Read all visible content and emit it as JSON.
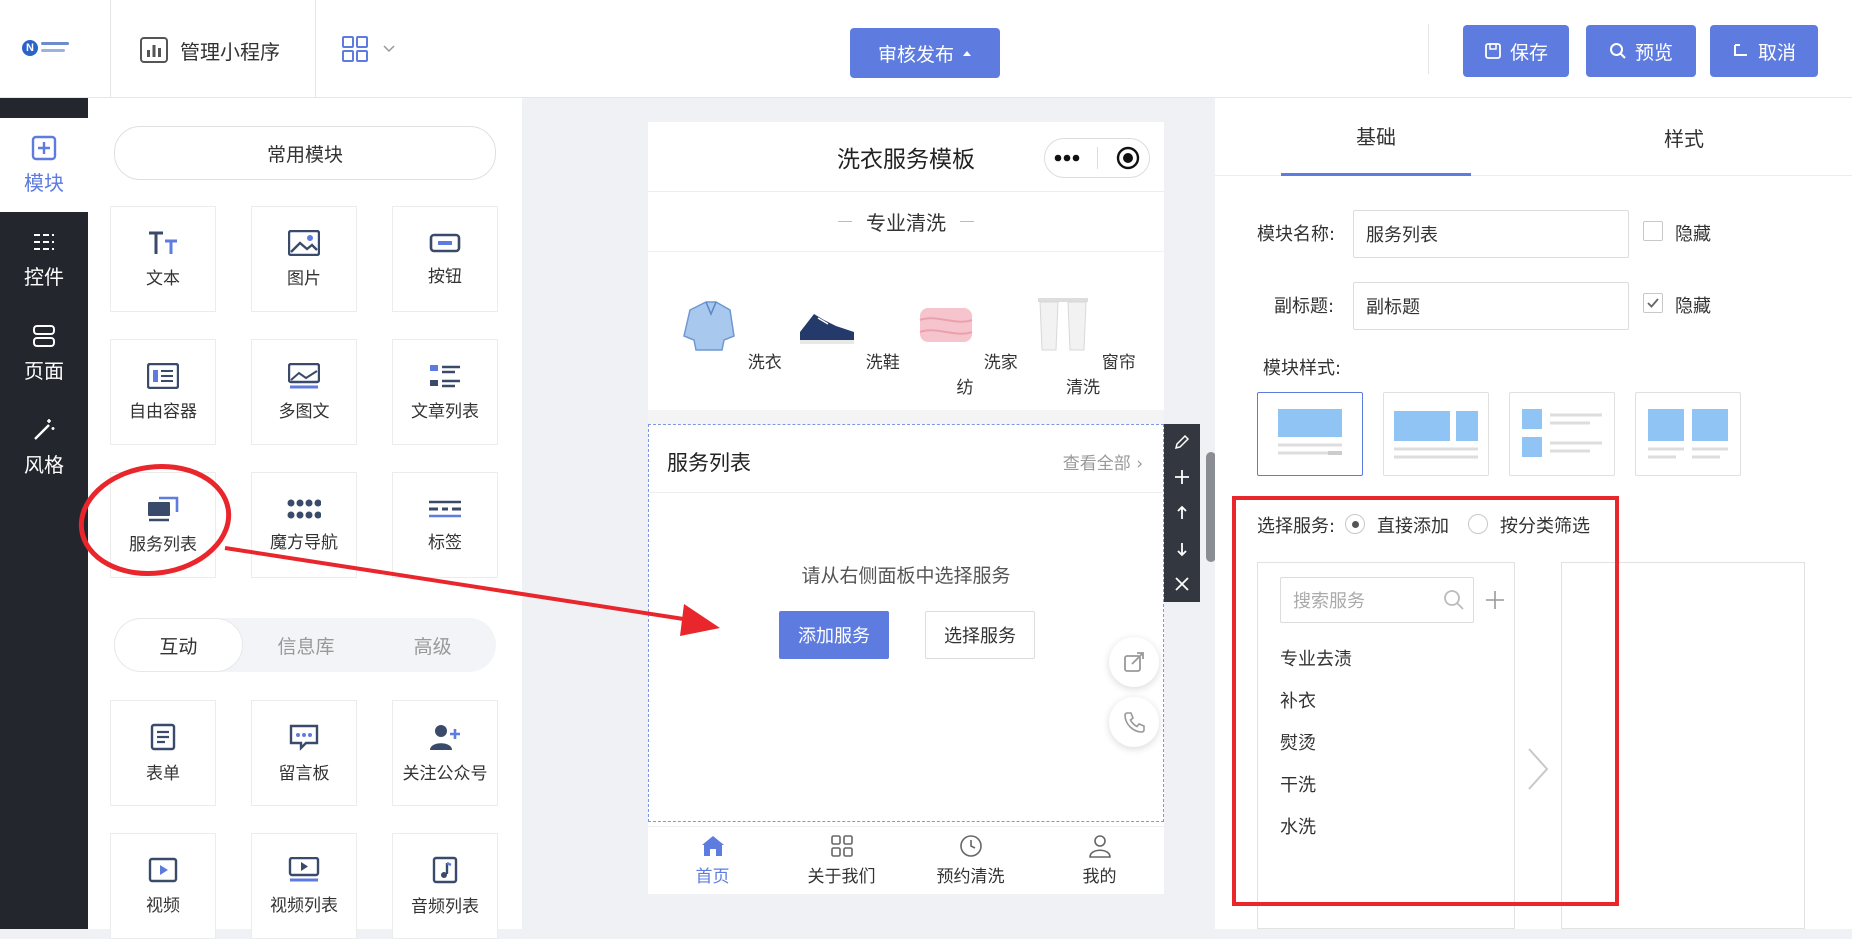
{
  "header": {
    "logo_alt": "logo",
    "manage_label": "管理小程序",
    "publish_label": "审核发布",
    "save_label": "保存",
    "preview_label": "预览",
    "cancel_label": "取消"
  },
  "rail": {
    "items": [
      {
        "label": "模块",
        "icon": "plus-square-icon",
        "active": true
      },
      {
        "label": "控件",
        "icon": "sliders-icon"
      },
      {
        "label": "页面",
        "icon": "server-icon"
      },
      {
        "label": "风格",
        "icon": "magic-wand-icon"
      }
    ]
  },
  "panel": {
    "common_label": "常用模块",
    "modules": [
      "文本",
      "图片",
      "按钮",
      "自由容器",
      "多图文",
      "文章列表",
      "服务列表",
      "魔方导航",
      "标签"
    ],
    "tabs": [
      "互动",
      "信息库",
      "高级"
    ],
    "interactive_modules": [
      "表单",
      "留言板",
      "关注公众号",
      "视频",
      "视频列表",
      "音频列表"
    ]
  },
  "phone": {
    "title": "洗衣服务模板",
    "subtitle": "专业清洗",
    "categories": [
      "洗衣",
      "洗鞋",
      "洗家纺",
      "窗帘清洗"
    ],
    "service_title": "服务列表",
    "service_more": "查看全部",
    "hint": "请从右侧面板中选择服务",
    "add_button": "添加服务",
    "select_button": "选择服务",
    "tabbar": [
      "首页",
      "关于我们",
      "预约清洗",
      "我的"
    ]
  },
  "settings": {
    "tab_basic": "基础",
    "tab_style": "样式",
    "name_label": "模块名称:",
    "name_value": "服务列表",
    "hide_label": "隐藏",
    "subtitle_label": "副标题:",
    "subtitle_value": "副标题",
    "style_label": "模块样式:",
    "select_label": "选择服务:",
    "radio_direct": "直接添加",
    "radio_category": "按分类筛选",
    "search_placeholder": "搜索服务",
    "services": [
      "专业去渍",
      "补衣",
      "熨烫",
      "干洗",
      "水洗"
    ]
  },
  "colors": {
    "accent": "#5e7ce0",
    "dark_rail": "#23262d",
    "annotation_red": "#e8262b"
  }
}
